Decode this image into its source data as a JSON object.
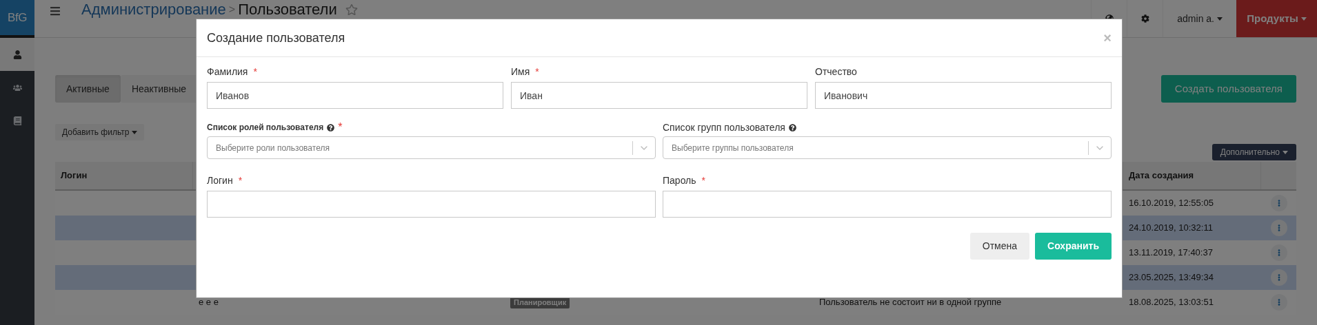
{
  "logo": {
    "text": "BfG"
  },
  "sidebar": {
    "items": [
      {
        "selected": true
      },
      {
        "selected": false
      },
      {
        "selected": false
      }
    ]
  },
  "topbar": {
    "breadcrumb": [
      {
        "text": "Администрирование",
        "kind": "link"
      },
      {
        "text": "Пользователи",
        "kind": "current"
      }
    ],
    "separator": ">",
    "user": "admin a.",
    "products": "Продукты"
  },
  "tabs": [
    {
      "label": "Активные",
      "selected": true
    },
    {
      "label": "Неактивные",
      "selected": false
    }
  ],
  "create_button": "Создать пользователя",
  "filter_button": "Добавить фильтр",
  "more_button": "Дополнительно",
  "table": {
    "columns": [
      "Логин",
      "",
      "",
      "",
      "Дата создания",
      ""
    ],
    "rows": [
      {
        "highlighted": false,
        "cells": [],
        "created": "16.10.2019, 12:55:05"
      },
      {
        "highlighted": true,
        "cells": [],
        "created": "24.10.2019, 10:32:11"
      },
      {
        "highlighted": false,
        "cells": [],
        "created": "13.11.2019, 17:40:37"
      },
      {
        "highlighted": true,
        "cells": [],
        "created": "23.05.2025, 13:49:34"
      },
      {
        "highlighted": false,
        "cells": [
          {
            "text": "е е е",
            "kind": "text"
          },
          {
            "text": "Планировщик",
            "kind": "badge"
          },
          {
            "text": "Пользователь не состоит ни в одной группе",
            "kind": "text"
          }
        ],
        "created": "18.08.2025, 13:03:51"
      }
    ]
  },
  "modal": {
    "title": "Создание пользователя",
    "close": "×",
    "name_fields": [
      {
        "label": "Фамилия",
        "required": true,
        "value": "Иванов"
      },
      {
        "label": "Имя",
        "required": true,
        "value": "Иван"
      },
      {
        "label": "Отчество",
        "required": false,
        "value": "Иванович"
      }
    ],
    "selects": [
      {
        "label": "Список ролей пользователя",
        "bold": true,
        "required": true,
        "placeholder": "Выберите роли пользователя"
      },
      {
        "label": "Список групп пользователя",
        "bold": false,
        "required": false,
        "placeholder": "Выберите группы пользователя"
      }
    ],
    "credential_fields": [
      {
        "label": "Логин",
        "required": true
      },
      {
        "label": "Пароль",
        "required": true
      }
    ],
    "required_mark": "*",
    "buttons": [
      {
        "label": "Отмена",
        "kind": "secondary"
      },
      {
        "label": "Сохранить",
        "kind": "primary"
      }
    ]
  }
}
